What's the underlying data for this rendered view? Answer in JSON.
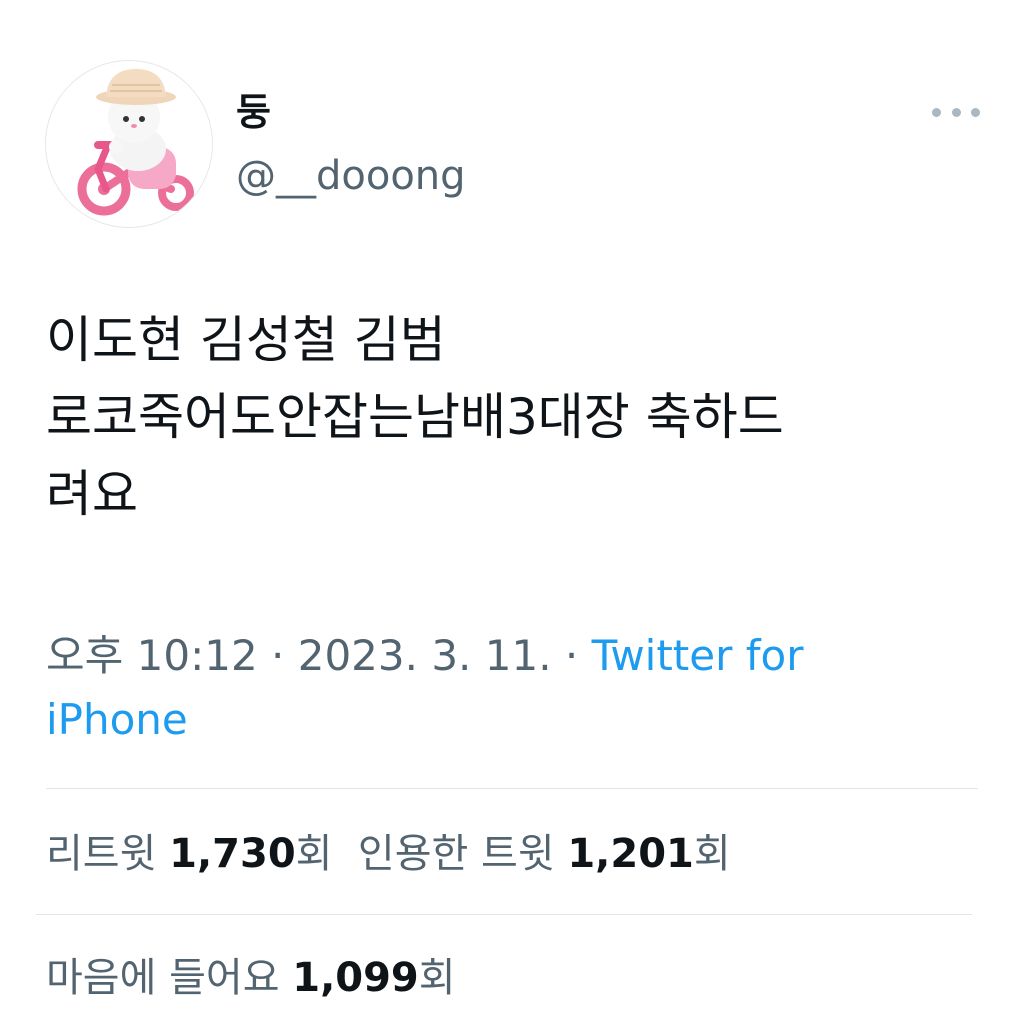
{
  "author": {
    "display_name": "둥",
    "handle": "@__dooong"
  },
  "tweet": {
    "text": "이도현 김성철 김범\n로코죽어도안잡는남배3대장 축하드\n려요"
  },
  "meta": {
    "time": "오후 10:12",
    "separator": " · ",
    "date": "2023. 3. 11.",
    "source": "Twitter for iPhone"
  },
  "stats": {
    "retweets_label": "리트윗 ",
    "retweets_count": "1,730",
    "retweets_unit": "회",
    "quotes_label": "인용한 트윗 ",
    "quotes_count": "1,201",
    "quotes_unit": "회",
    "likes_label": "마음에 들어요 ",
    "likes_count": "1,099",
    "likes_unit": "회"
  },
  "icons": {
    "more": "more-horizontal-icon",
    "avatar": "kitten-on-tricycle-figure"
  },
  "colors": {
    "link": "#1d9bf0",
    "secondary_text": "#536471",
    "primary_text": "#0f1419"
  }
}
